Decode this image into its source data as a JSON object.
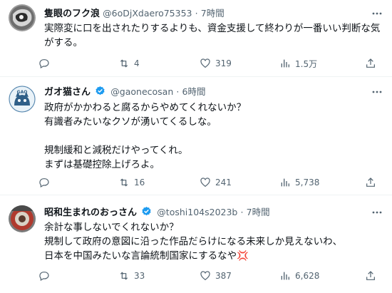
{
  "tweets": [
    {
      "name": "隻眼のフク浪",
      "handle": "@6oDjXdaero75353",
      "sep": "·",
      "time": "7時間",
      "verified": false,
      "body": "実際変に口を出されたりするよりも、資金支援して終わりが一番いい判断な気がする。",
      "replies": "",
      "retweets": "4",
      "likes": "319",
      "views": "1.5万"
    },
    {
      "name": "ガオ猫さん",
      "handle": "@gaonecosan",
      "sep": "·",
      "time": "6時間",
      "verified": true,
      "body": "政府がかかわると腐るからやめてくれないか？\n有識者みたいなクソが湧いてくるしな。\n\n規制緩和と減税だけやってくれ。\nまずは基礎控除上げろよ。",
      "replies": "",
      "retweets": "16",
      "likes": "241",
      "views": "5,738"
    },
    {
      "name": "昭和生まれのおっさん",
      "handle": "@toshi104s2023b",
      "sep": "·",
      "time": "7時間",
      "verified": true,
      "body": "余計な事しないでくれないか？\n規制して政府の意図に沿った作品だらけになる未来しか見えないわ、\n日本を中国みたいな言論統制国家にするなや💢",
      "replies": "",
      "retweets": "33",
      "likes": "387",
      "views": "6,628"
    }
  ],
  "icons": {
    "more": "more-icon",
    "reply": "reply-icon",
    "retweet": "retweet-icon",
    "like": "like-icon",
    "views": "views-icon",
    "share": "share-icon"
  },
  "colors": {
    "text": "#0f1419",
    "secondary": "#536471",
    "verified": "#1d9bf0",
    "divider": "#eff3f4"
  }
}
